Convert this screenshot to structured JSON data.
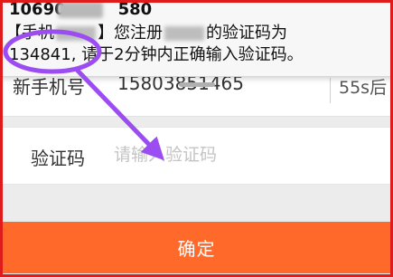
{
  "notification": {
    "sender_visible": "10690",
    "sender_suffix": "580",
    "line1_start": "【手机",
    "line1_mid": "】您注册",
    "line1_end": "的验证码为",
    "code": "134841,",
    "line2_rest": "请于2分钟内正确输入验证码。"
  },
  "form": {
    "phone_label": "新手机号",
    "phone_value": "15803851465",
    "countdown": "55s后",
    "code_label": "验证码",
    "code_placeholder": "请输入验证码",
    "confirm_label": "确定"
  },
  "colors": {
    "accent": "#ff6a2b",
    "annotation": "#9b4df2",
    "frame": "#e01b1b"
  }
}
